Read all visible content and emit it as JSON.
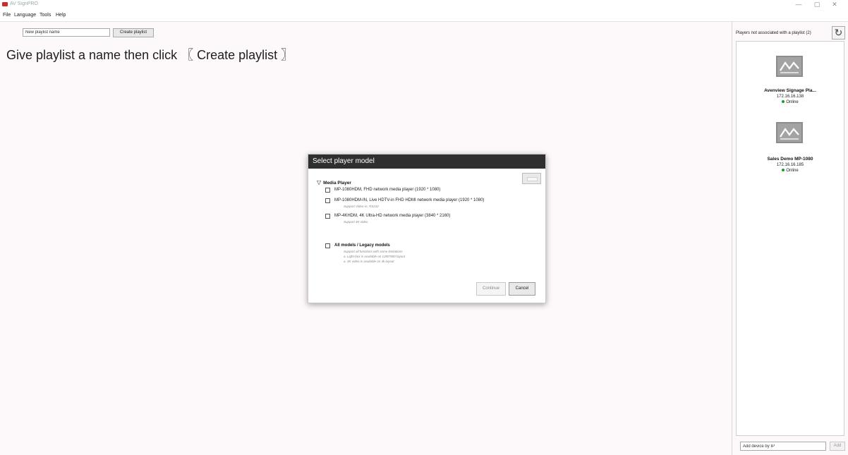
{
  "app": {
    "title": "AV SignPRO",
    "window_controls": {
      "minimize": "—",
      "maximize": "▢",
      "close": "✕"
    }
  },
  "menu": {
    "items": [
      "File",
      "Language",
      "Tools",
      "Help"
    ]
  },
  "toolbar": {
    "playlist_name_value": "New playlist name",
    "create_button_label": "Create playlist"
  },
  "hint": "Give playlist a name then click 〖 Create playlist 〗",
  "right_panel": {
    "header": "Players not associated with a playlist (2)",
    "refresh_icon": "↻",
    "players": [
      {
        "name": "Avenview Signage Pla...",
        "ip": "172.16.16.138",
        "status": "Online"
      },
      {
        "name": "Sales Demo MP-1080",
        "ip": "172.16.16.185",
        "status": "Online"
      }
    ],
    "add_ip_value": "Add device by IP",
    "add_button_label": "Add"
  },
  "dialog": {
    "title": "Select player model",
    "group": {
      "icon": "▽",
      "label": "Media Player"
    },
    "options": [
      {
        "label": "MP-1080HDM, FHD network media player (1920 * 1080)",
        "note": ""
      },
      {
        "label": "MP-1080HDM-IN, Live HDTV-in FHD HDMI network media player (1920 * 1080)",
        "note": "Support Video-in, RS232"
      },
      {
        "label": "MP-4KHDM, 4K Ultra-HD network media player (3840 * 2160)",
        "note": "Support 4K video"
      }
    ],
    "legacy": {
      "label": "All models / Legacy models",
      "notes": [
        "Support all functions with some limitations",
        "a. Light-box is available on 1280*800 layout",
        "a. 4K video is available on 4k layout"
      ]
    },
    "continue_label": "Continue",
    "cancel_label": "Cancel"
  },
  "colors": {
    "dialog_header": "#2f2f2f",
    "online": "#1b9c2a",
    "logo": "#cf2a2a"
  }
}
